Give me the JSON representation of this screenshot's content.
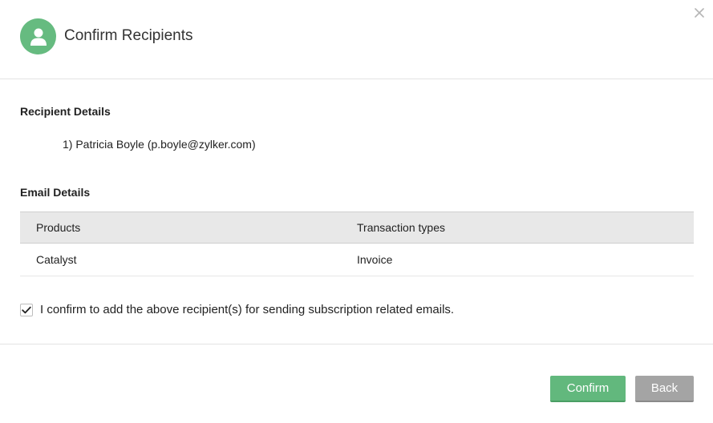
{
  "dialog": {
    "title": "Confirm Recipients",
    "close_icon": "close-icon",
    "avatar_icon": "user-icon",
    "accent_color": "#66bb80"
  },
  "recipient_details": {
    "label": "Recipient Details",
    "items": [
      "1) Patricia Boyle  (p.boyle@zylker.com)"
    ]
  },
  "email_details": {
    "label": "Email Details",
    "columns": [
      "Products",
      "Transaction types"
    ],
    "rows": [
      [
        "Catalyst",
        "Invoice"
      ]
    ]
  },
  "confirmation": {
    "checked": true,
    "text": "I confirm to add the above recipient(s) for sending subscription related emails."
  },
  "buttons": {
    "confirm_label": "Confirm",
    "back_label": "Back"
  }
}
